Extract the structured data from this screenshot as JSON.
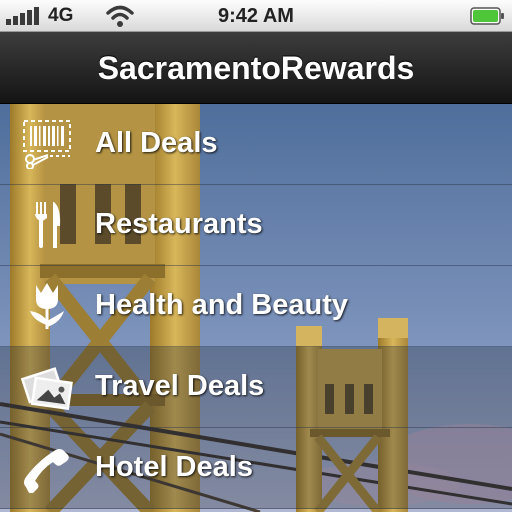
{
  "status_bar": {
    "carrier": "4G",
    "time": "9:42 AM",
    "icons": [
      "signal-bars-icon",
      "wifi-icon",
      "battery-icon"
    ]
  },
  "nav": {
    "title": "SacramentoRewards"
  },
  "menu": {
    "items": [
      {
        "label": "All Deals",
        "icon": "barcode-scissors-icon"
      },
      {
        "label": "Restaurants",
        "icon": "fork-knife-icon"
      },
      {
        "label": "Health and Beauty",
        "icon": "tulip-icon"
      },
      {
        "label": "Travel Deals",
        "icon": "photos-icon"
      },
      {
        "label": "Hotel Deals",
        "icon": "phone-handset-icon"
      }
    ]
  },
  "colors": {
    "sky_top": "#4f6e9b",
    "sky_bottom": "#a7b6d2",
    "tower": "#c9a643",
    "battery": "#4fc53a"
  }
}
